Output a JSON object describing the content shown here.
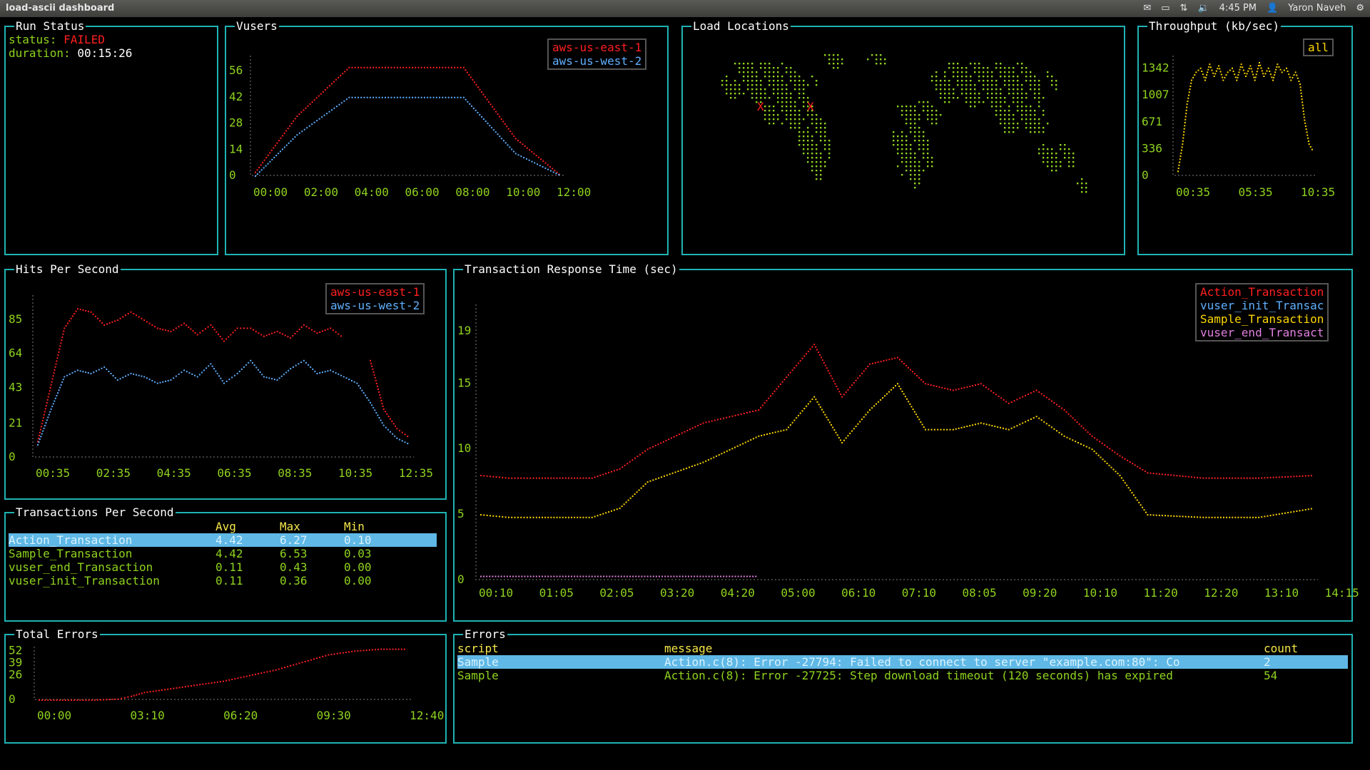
{
  "window": {
    "title": "load-ascii dashboard",
    "clock": "4:45 PM",
    "user": "Yaron Naveh"
  },
  "run_status": {
    "title": "Run Status",
    "status_label": "status: ",
    "status_value": "FAILED",
    "duration_label": "duration: ",
    "duration_value": "00:15:26"
  },
  "vusers": {
    "title": "Vusers",
    "legend": [
      "aws-us-east-1",
      "aws-us-west-2"
    ],
    "chart_data": {
      "type": "line",
      "yticks": [
        "56",
        "42",
        "28",
        "14",
        "0"
      ],
      "xticks": [
        "00:00",
        "02:00",
        "04:00",
        "06:00",
        "08:00",
        "10:00",
        "12:00"
      ],
      "ylim": [
        0,
        64
      ],
      "series": [
        {
          "name": "aws-us-east-1",
          "color": "#ff2020",
          "x": [
            0,
            2,
            4.5,
            10,
            12.5,
            14.7
          ],
          "y": [
            2,
            32,
            58,
            58,
            20,
            0
          ]
        },
        {
          "name": "aws-us-west-2",
          "color": "#5fb0ff",
          "x": [
            0,
            2,
            4.5,
            10,
            12.5,
            14.7
          ],
          "y": [
            0,
            22,
            42,
            42,
            12,
            0
          ]
        }
      ]
    }
  },
  "load_locations": {
    "title": "Load Locations",
    "markers": [
      "X",
      "X"
    ]
  },
  "throughput": {
    "title": "Throughput (kb/sec)",
    "legend": [
      "all"
    ],
    "chart_data": {
      "type": "line",
      "yticks": [
        "1342",
        "1007",
        "671",
        "336",
        "0"
      ],
      "xticks": [
        "00:35",
        "05:35",
        "10:35"
      ],
      "ylim": [
        0,
        1500
      ],
      "series": [
        {
          "name": "all",
          "color": "#ffd700",
          "x": [
            0,
            0.5,
            1,
            1.5,
            2,
            2.5,
            3,
            3.5,
            4,
            4.5,
            5,
            5.5,
            6,
            6.5,
            7,
            7.5,
            8,
            8.5,
            9,
            9.5,
            10,
            10.5,
            11,
            11.5,
            12,
            12.5,
            13,
            13.5,
            14,
            14.5,
            15
          ],
          "y": [
            60,
            400,
            900,
            1200,
            1300,
            1350,
            1200,
            1400,
            1250,
            1380,
            1200,
            1300,
            1350,
            1200,
            1400,
            1250,
            1380,
            1200,
            1420,
            1250,
            1350,
            1200,
            1400,
            1300,
            1350,
            1200,
            1300,
            1150,
            700,
            400,
            300
          ]
        }
      ]
    }
  },
  "hits": {
    "title": "Hits Per Second",
    "legend": [
      "aws-us-east-1",
      "aws-us-west-2"
    ],
    "chart_data": {
      "type": "line",
      "yticks": [
        "85",
        "64",
        "43",
        "21",
        "0"
      ],
      "xticks": [
        "00:35",
        "02:35",
        "04:35",
        "06:35",
        "08:35",
        "10:35",
        "12:35"
      ],
      "ylim": [
        0,
        100
      ],
      "series": [
        {
          "name": "aws-us-east-1",
          "color": "#ff2020",
          "x": [
            0,
            0.5,
            1,
            1.5,
            2,
            2.5,
            3,
            3.5,
            4,
            4.5,
            5,
            5.5,
            6,
            6.5,
            7,
            7.5,
            8,
            8.5,
            9,
            9.5,
            10,
            10.5,
            11,
            11.5,
            12,
            12.5,
            13,
            13.5,
            14
          ],
          "y": [
            10,
            45,
            80,
            92,
            90,
            82,
            85,
            90,
            85,
            80,
            78,
            83,
            76,
            82,
            72,
            80,
            80,
            75,
            78,
            74,
            82,
            77,
            80,
            74,
            null,
            60,
            30,
            18,
            12
          ]
        },
        {
          "name": "aws-us-west-2",
          "color": "#5fb0ff",
          "x": [
            0,
            0.5,
            1,
            1.5,
            2,
            2.5,
            3,
            3.5,
            4,
            4.5,
            5,
            5.5,
            6,
            6.5,
            7,
            7.5,
            8,
            8.5,
            9,
            9.5,
            10,
            10.5,
            11,
            11.5,
            12,
            12.5,
            13,
            13.5,
            14
          ],
          "y": [
            8,
            30,
            50,
            54,
            52,
            56,
            48,
            52,
            50,
            46,
            48,
            54,
            50,
            58,
            46,
            52,
            60,
            50,
            48,
            55,
            60,
            52,
            54,
            50,
            46,
            34,
            20,
            12,
            8
          ]
        }
      ]
    }
  },
  "response_time": {
    "title": "Transaction Response Time (sec)",
    "legend": [
      "Action_Transaction",
      "vuser_init_Transac",
      "Sample_Transaction",
      "vuser_end_Transact"
    ],
    "chart_data": {
      "type": "line",
      "yticks": [
        "19",
        "15",
        "10",
        "5",
        "0"
      ],
      "xticks": [
        "00:10",
        "01:05",
        "02:05",
        "03:20",
        "04:20",
        "05:00",
        "06:10",
        "07:10",
        "08:05",
        "09:20",
        "10:10",
        "11:20",
        "12:20",
        "13:10",
        "14:15"
      ],
      "ylim": [
        0,
        21
      ],
      "series": [
        {
          "name": "Action_Transaction",
          "color": "#ff2020",
          "x": [
            0,
            0.5,
            1,
            2,
            2.5,
            3,
            4,
            5,
            5.5,
            6,
            6.5,
            7,
            7.5,
            8,
            8.5,
            9,
            9.5,
            10,
            10.5,
            11,
            11.5,
            12,
            13,
            14,
            15
          ],
          "y": [
            8,
            7.8,
            7.8,
            7.8,
            8.5,
            10,
            12,
            13,
            15.5,
            18,
            14,
            16.5,
            17,
            15,
            14.5,
            15,
            13.5,
            14.5,
            13,
            11,
            9.5,
            8.2,
            7.8,
            7.8,
            8
          ]
        },
        {
          "name": "Sample_Transaction",
          "color": "#ffd700",
          "x": [
            0,
            0.5,
            1,
            2,
            2.5,
            3,
            4,
            5,
            5.5,
            6,
            6.5,
            7,
            7.5,
            8,
            8.5,
            9,
            9.5,
            10,
            10.5,
            11,
            11.5,
            12,
            13,
            14,
            15
          ],
          "y": [
            5,
            4.8,
            4.8,
            4.8,
            5.5,
            7.5,
            9,
            11,
            11.5,
            14,
            10.5,
            13,
            15,
            11.5,
            11.5,
            12,
            11.5,
            12.5,
            11,
            10,
            8,
            5,
            4.8,
            4.8,
            5.5
          ]
        },
        {
          "name": "vuser_end_Transact",
          "color": "#e080e0",
          "x": [
            0,
            1,
            2,
            3,
            4,
            5
          ],
          "y": [
            0.3,
            0.3,
            0.3,
            0.3,
            0.3,
            0.3
          ]
        }
      ]
    }
  },
  "tps": {
    "title": "Transactions Per Second",
    "headers": {
      "name": "",
      "avg": "Avg",
      "max": "Max",
      "min": "Min"
    },
    "rows": [
      {
        "name": "Action_Transaction",
        "avg": "4.42",
        "max": "6.27",
        "min": "0.10"
      },
      {
        "name": "Sample_Transaction",
        "avg": "4.42",
        "max": "6.53",
        "min": "0.03"
      },
      {
        "name": "vuser_end_Transaction",
        "avg": "0.11",
        "max": "0.43",
        "min": "0.00"
      },
      {
        "name": "vuser_init_Transaction",
        "avg": "0.11",
        "max": "0.36",
        "min": "0.00"
      }
    ]
  },
  "total_errors": {
    "title": "Total Errors",
    "chart_data": {
      "type": "line",
      "yticks": [
        "52",
        "39",
        "26",
        "0"
      ],
      "xticks": [
        "00:00",
        "03:10",
        "06:20",
        "09:30",
        "12:40"
      ],
      "ylim": [
        0,
        56
      ],
      "series": [
        {
          "name": "errors",
          "color": "#ff2020",
          "x": [
            0,
            1,
            2,
            3,
            3.5,
            4,
            5,
            6,
            7,
            8,
            9,
            10,
            11,
            12,
            13,
            14
          ],
          "y": [
            0,
            0,
            0,
            1,
            4,
            8,
            12,
            16,
            20,
            26,
            32,
            40,
            48,
            52,
            54,
            54
          ]
        }
      ]
    }
  },
  "errors": {
    "title": "Errors",
    "headers": {
      "script": "script",
      "message": "message",
      "count": "count"
    },
    "rows": [
      {
        "script": "Sample",
        "message": "Action.c(8): Error -27794: Failed to connect to server \"example.com:80\": Co",
        "count": "2"
      },
      {
        "script": "Sample",
        "message": "Action.c(8): Error -27725: Step download timeout (120 seconds) has expired",
        "count": "54"
      }
    ]
  }
}
